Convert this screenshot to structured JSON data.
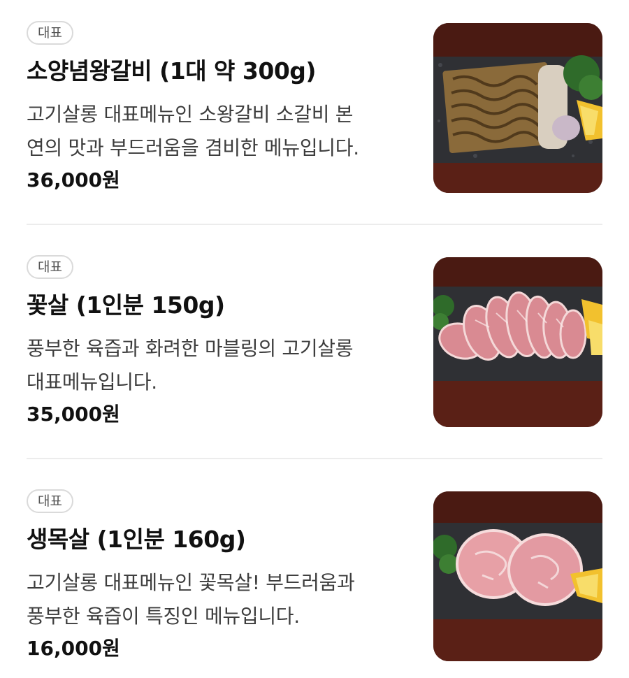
{
  "menu": {
    "items": [
      {
        "badge": "대표",
        "name": "소양념왕갈비 (1대 약 300g)",
        "description_lines": [
          "고기살롱 대표메뉴인 소왕갈비 소갈비 본",
          "연의 맛과 부드러움을 겸비한 메뉴입니다."
        ],
        "price": "36,000원"
      },
      {
        "badge": "대표",
        "name": "꽃살 (1인분 150g)",
        "description_lines": [
          "풍부한 육즙과 화려한 마블링의 고기살롱",
          "대표메뉴입니다."
        ],
        "price": "35,000원"
      },
      {
        "badge": "대표",
        "name": "생목살 (1인분 160g)",
        "description_lines": [
          "고기살롱 대표메뉴인 꽃목살! 부드러움과",
          "풍부한 육즙이 특징인 메뉴입니다."
        ],
        "price": "16,000원"
      }
    ]
  },
  "colors": {
    "text_primary": "#111111",
    "text_secondary": "#3d3d3d",
    "badge_border": "#dadada",
    "divider": "#ececec"
  }
}
